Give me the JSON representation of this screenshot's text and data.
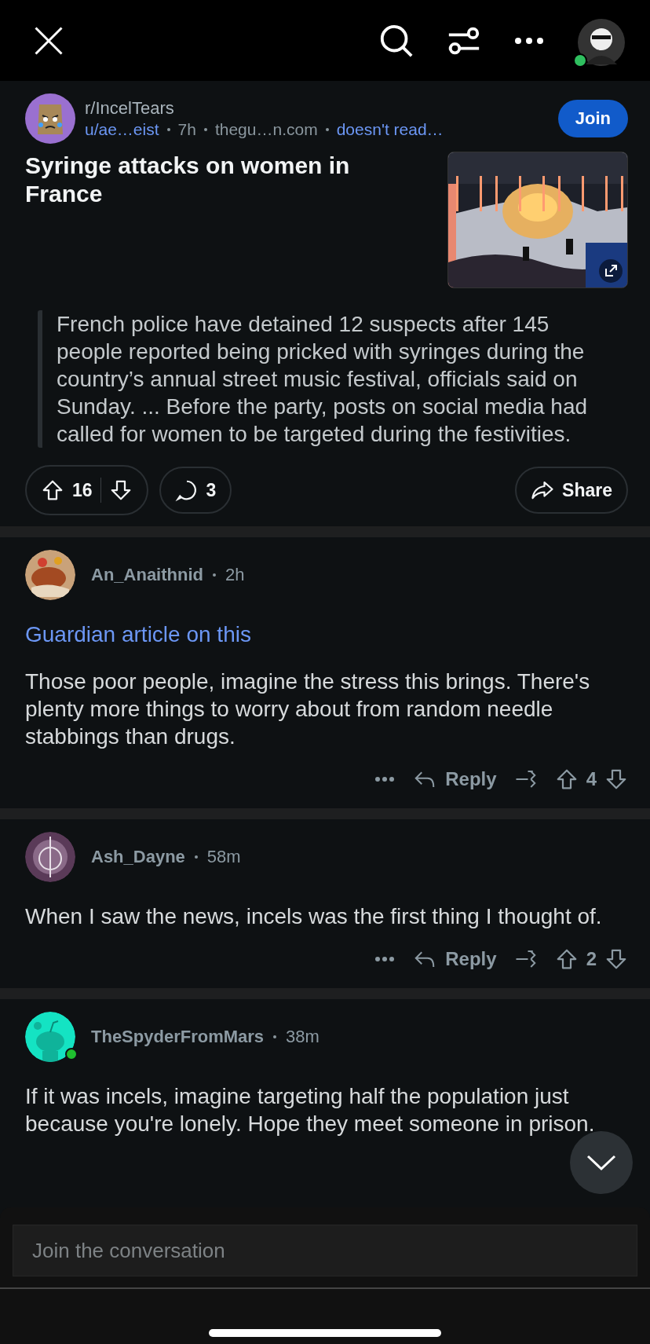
{
  "top_bar": {
    "avatar_online": true
  },
  "post": {
    "subreddit": "r/IncelTears",
    "author": "u/ae…eist",
    "time": "7h",
    "domain": "thegu…n.com",
    "flair": "doesn't read…",
    "join": "Join",
    "title": "Syringe attacks on women in France",
    "quote": "French police have detained 12 suspects after 145 people reported being pricked with syringes during the country’s annual street music festival, officials said on Sunday. ... Before the party, posts on social media had called for women to be targeted during the festivities.",
    "score": "16",
    "comments": "3",
    "share": "Share"
  },
  "comments": [
    {
      "author": "An_Anaithnid",
      "time": "2h",
      "online": false,
      "link": "Guardian article on this",
      "text": "Those poor people, imagine the stress this brings. There's plenty more things to worry about from random needle stabbings than drugs.",
      "reply": "Reply",
      "score": "4"
    },
    {
      "author": "Ash_Dayne",
      "time": "58m",
      "online": false,
      "text": "When I saw the news, incels was the first thing I thought of.",
      "reply": "Reply",
      "score": "2"
    },
    {
      "author": "TheSpyderFromMars",
      "time": "38m",
      "avatar": {
        "kind": "silhouette"
      },
      "online": true,
      "text": "If it was incels, imagine targeting half the population just because you're lonely. Hope they meet someone in prison."
    }
  ],
  "composer": {
    "placeholder": "Join the conversation"
  }
}
